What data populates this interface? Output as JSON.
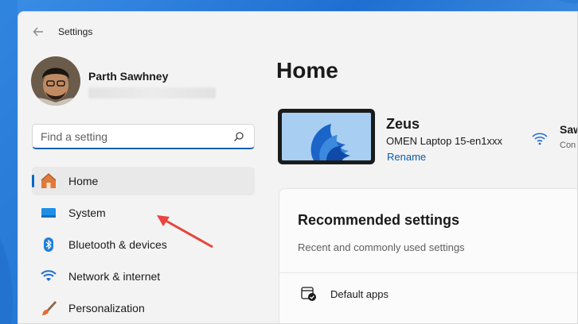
{
  "window": {
    "app_title": "Settings"
  },
  "profile": {
    "name": "Parth Sawhney"
  },
  "search": {
    "placeholder": "Find a setting"
  },
  "nav": {
    "items": [
      {
        "label": "Home",
        "icon": "home-icon",
        "active": true
      },
      {
        "label": "System",
        "icon": "system-icon",
        "active": false
      },
      {
        "label": "Bluetooth & devices",
        "icon": "bluetooth-icon",
        "active": false
      },
      {
        "label": "Network & internet",
        "icon": "network-icon",
        "active": false
      },
      {
        "label": "Personalization",
        "icon": "brush-icon",
        "active": false
      }
    ]
  },
  "main": {
    "page_title": "Home",
    "device": {
      "name": "Zeus",
      "model": "OMEN Laptop 15-en1xxx",
      "rename_label": "Rename"
    },
    "wifi": {
      "name": "Saw",
      "status": "Con"
    },
    "recommended": {
      "title": "Recommended settings",
      "subtitle": "Recent and commonly used settings",
      "items": [
        {
          "label": "Default apps",
          "icon": "default-apps-icon"
        }
      ]
    }
  },
  "colors": {
    "accent": "#0067c0",
    "annotation_arrow": "#e8453c"
  }
}
